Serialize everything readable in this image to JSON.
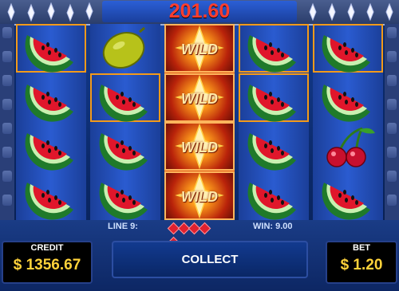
{
  "header": {
    "total_win": "201.60"
  },
  "reels": [
    [
      "watermelon",
      "watermelon",
      "watermelon",
      "watermelon"
    ],
    [
      "lemon",
      "watermelon",
      "watermelon",
      "watermelon"
    ],
    [
      "wild",
      "wild",
      "wild",
      "wild"
    ],
    [
      "watermelon",
      "watermelon",
      "watermelon",
      "watermelon"
    ],
    [
      "watermelon",
      "watermelon",
      "cherries",
      "watermelon"
    ]
  ],
  "wild_label": "WILD",
  "status": {
    "line_label": "LINE 9:",
    "win_label": "WIN: 9.00",
    "gems": 5
  },
  "credit": {
    "title": "CREDIT",
    "value": "$ 1356.67"
  },
  "collect": {
    "label": "COLLECT"
  },
  "bet": {
    "title": "BET",
    "value": "$ 1.20"
  },
  "colors": {
    "highlight": "#f39a1a",
    "win_text": "#ff3d2e",
    "value_text": "#ffd23a"
  }
}
